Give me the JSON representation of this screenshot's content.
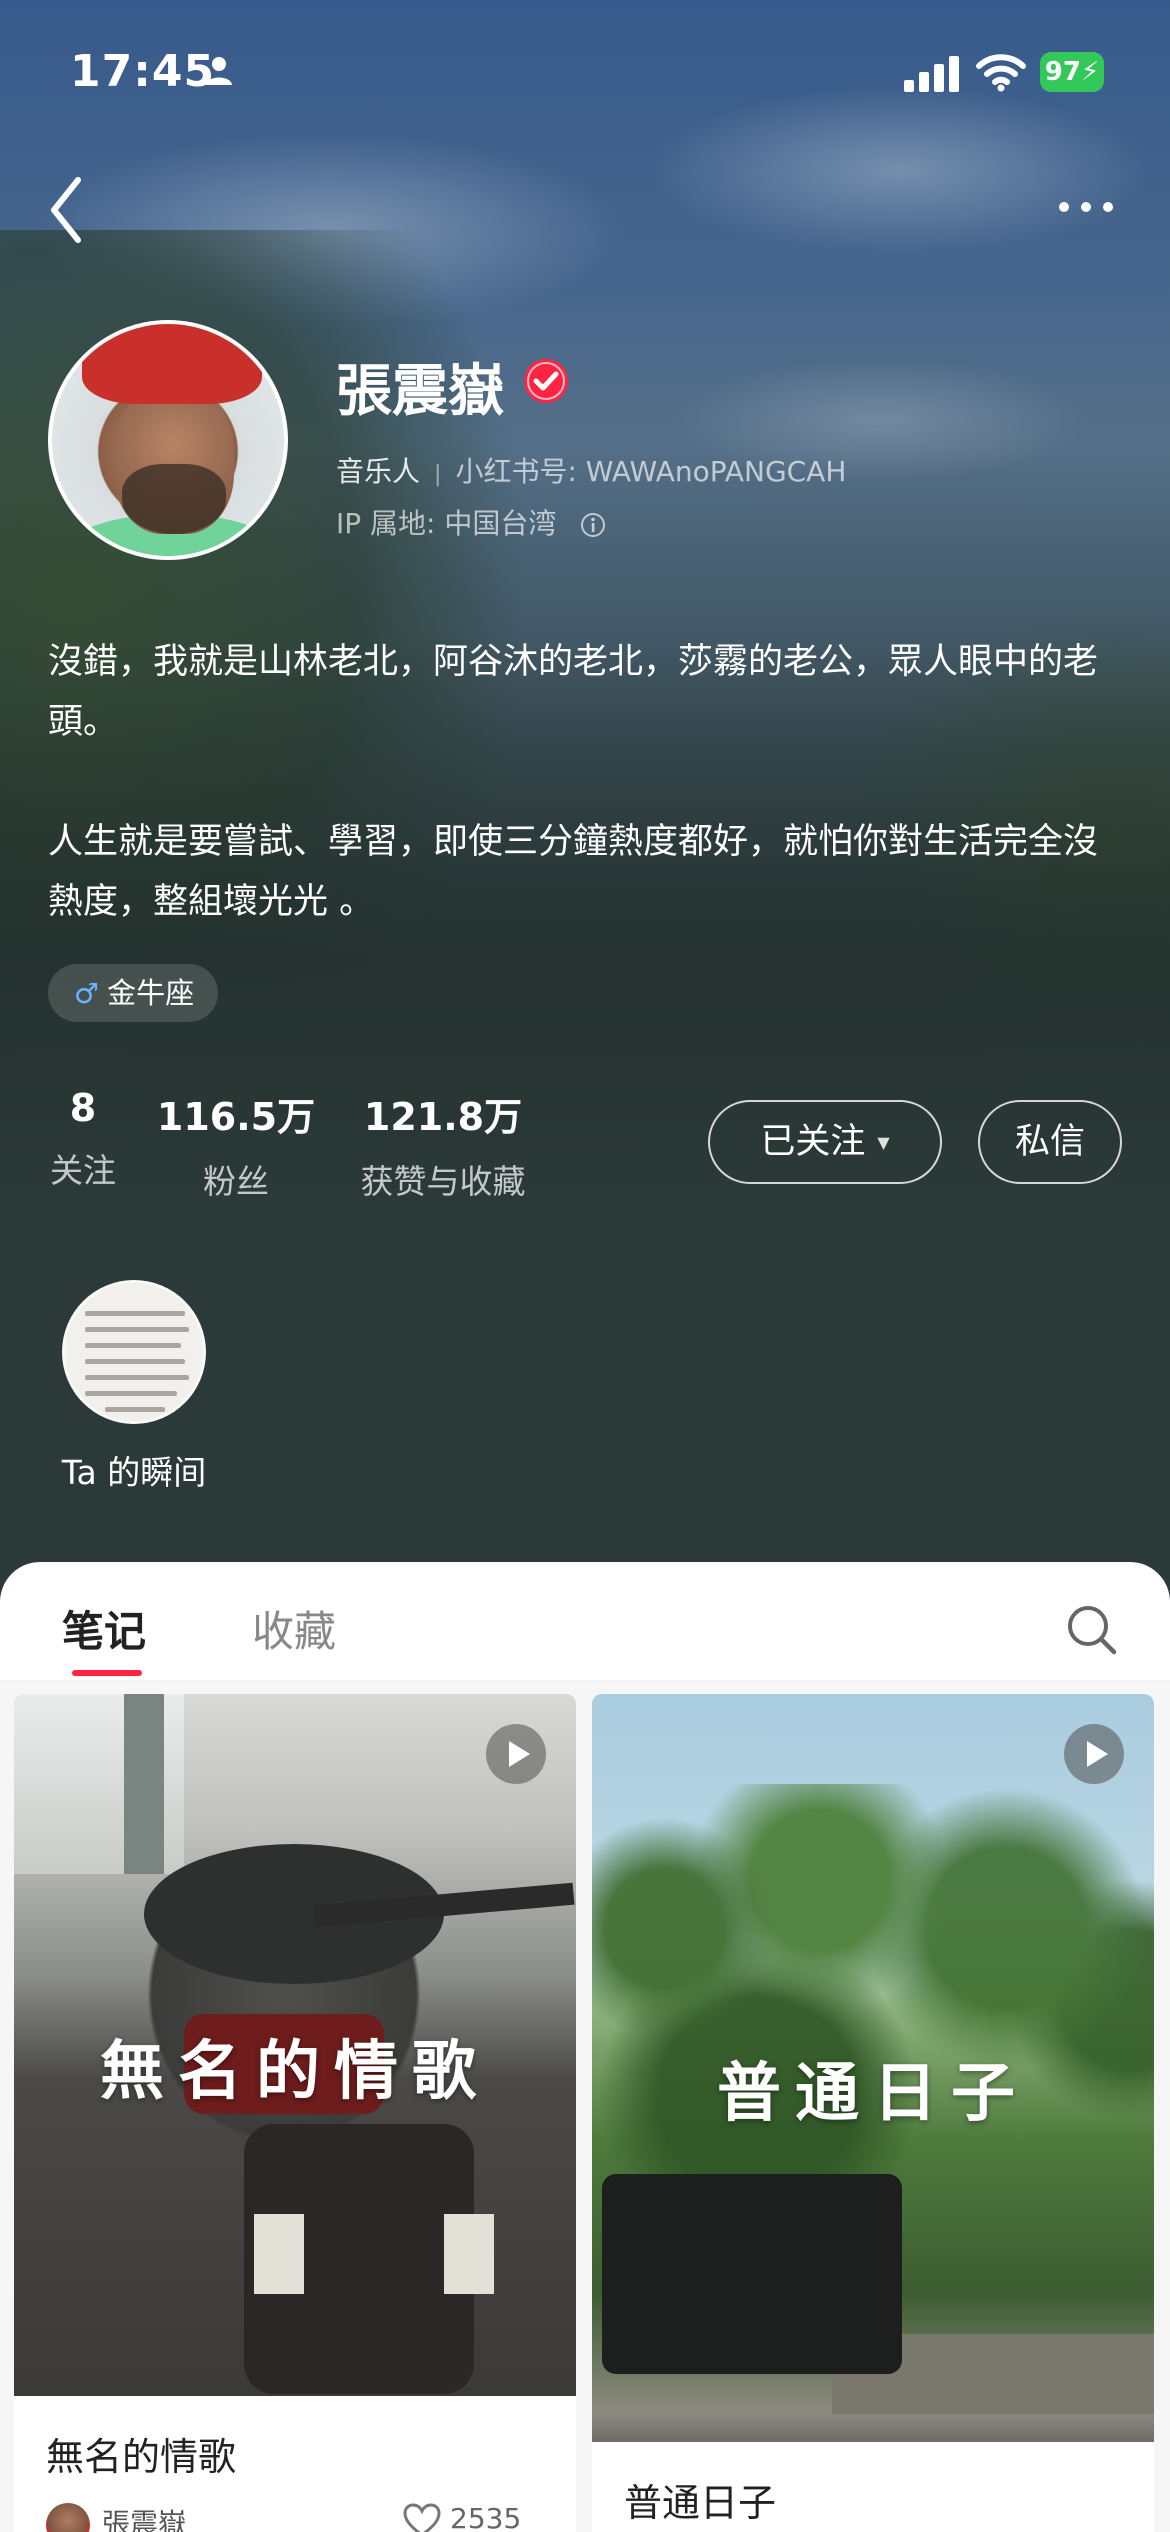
{
  "status_bar": {
    "time": "17:45",
    "battery": "97"
  },
  "profile": {
    "name": "張震嶽",
    "role": "音乐人",
    "id_label": "小红书号:",
    "id_value": "WAWAnoPANGCAH",
    "ip_location": "IP 属地: 中国台湾",
    "bio_lines": [
      "沒錯，我就是山林老北，阿谷沐的老北，莎霧的老公，眾人眼中的老頭。",
      "人生就是要嘗試、學習，即使三分鐘熱度都好，就怕你對生活完全沒熱度，整組壞光光 。"
    ],
    "tag": "金牛座"
  },
  "stats": [
    {
      "value": "8",
      "label": "关注"
    },
    {
      "value": "116.5万",
      "label": "粉丝"
    },
    {
      "value": "121.8万",
      "label": "获赞与收藏"
    }
  ],
  "actions": {
    "follow_label": "已关注",
    "message_label": "私信"
  },
  "moments": {
    "label": "Ta 的瞬间"
  },
  "tabs": [
    {
      "label": "笔记",
      "active": true
    },
    {
      "label": "收藏",
      "active": false
    }
  ],
  "notes": [
    {
      "cover_text": "無名的情歌",
      "title": "無名的情歌",
      "author": "張震嶽",
      "likes": "2535",
      "type": "video"
    },
    {
      "cover_text": "普通日子",
      "title": "普通日子",
      "type": "video"
    }
  ],
  "colors": {
    "accent": "#ff2442",
    "verified": "#ff2442",
    "battery": "#34c759"
  }
}
